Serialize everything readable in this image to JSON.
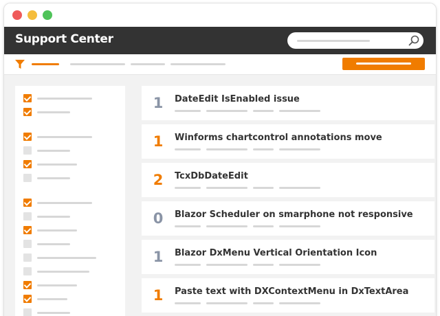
{
  "window": {
    "controls": [
      "close",
      "minimize",
      "maximize"
    ],
    "colors": {
      "close": "#ef5a5a",
      "minimize": "#f5bd3c",
      "maximize": "#4fc359"
    }
  },
  "header": {
    "title": "Support Center",
    "background": "#333333"
  },
  "search": {
    "icon": "search-icon",
    "placeholder": ""
  },
  "toolbar": {
    "filter_icon": "filter-icon",
    "accent_color": "#f07c00"
  },
  "sidebar": {
    "checkboxes": [
      {
        "checked": true
      },
      {
        "checked": true
      },
      {
        "checked": true
      },
      {
        "checked": false
      },
      {
        "checked": true
      },
      {
        "checked": false
      },
      {
        "checked": true
      },
      {
        "checked": false
      },
      {
        "checked": true
      },
      {
        "checked": false
      },
      {
        "checked": false
      },
      {
        "checked": false
      },
      {
        "checked": true
      },
      {
        "checked": true
      },
      {
        "checked": false
      }
    ]
  },
  "tickets": [
    {
      "count": "1",
      "title": "DateEdit IsEnabled issue",
      "highlight": false
    },
    {
      "count": "1",
      "title": "Winforms chartcontrol annotations move",
      "highlight": true
    },
    {
      "count": "2",
      "title": "TcxDbDateEdit",
      "highlight": true
    },
    {
      "count": "0",
      "title": "Blazor Scheduler on smarphone not responsive",
      "highlight": false
    },
    {
      "count": "1",
      "title": "Blazor DxMenu Vertical Orientation Icon",
      "highlight": false
    },
    {
      "count": "1",
      "title": "Paste text with DXContextMenu in DxTextArea",
      "highlight": true
    }
  ],
  "colors": {
    "accent": "#f07c00",
    "muted_count": "#8a94a6",
    "placeholder_line": "#d7d7d7"
  }
}
